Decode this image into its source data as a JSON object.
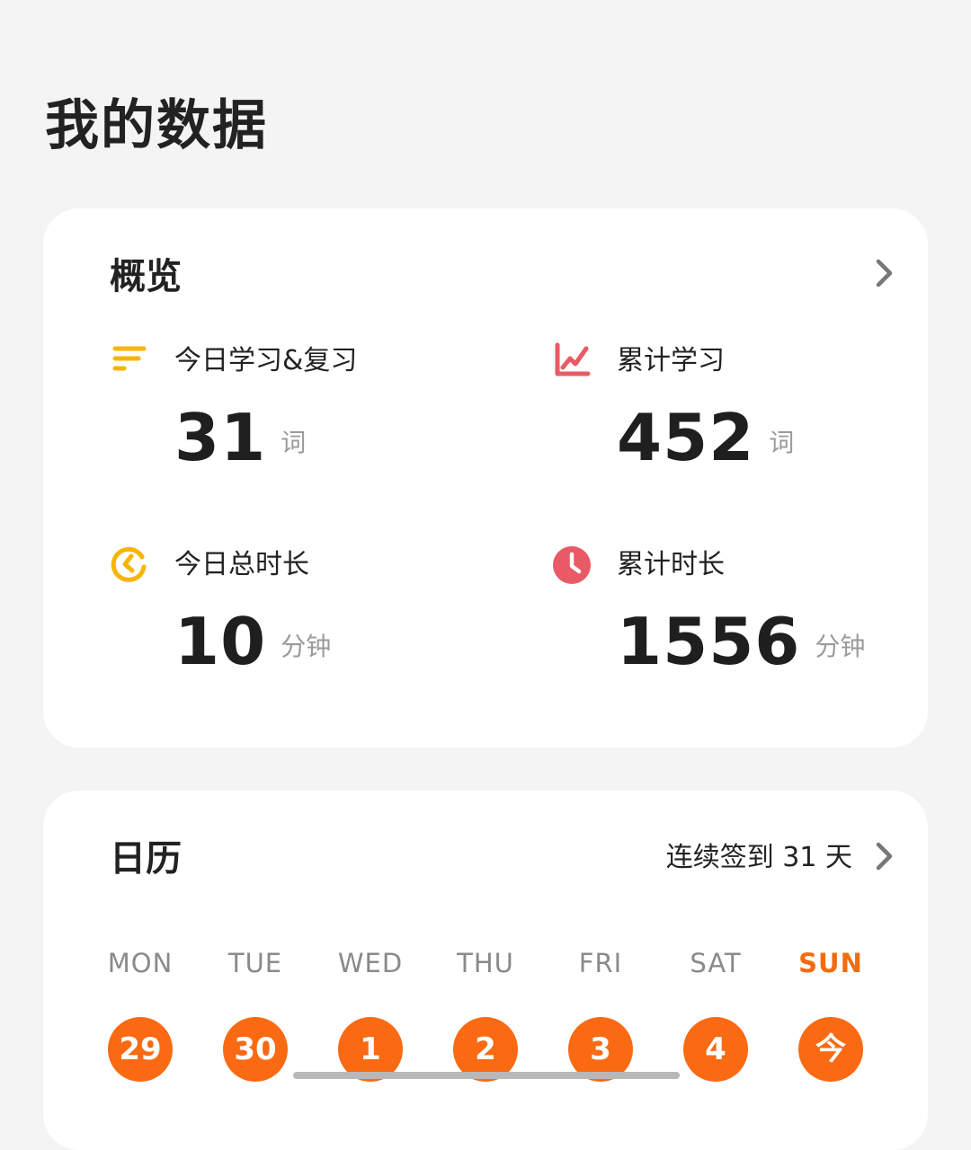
{
  "page": {
    "title": "我的数据"
  },
  "overview": {
    "title": "概览",
    "stats": [
      {
        "icon": "list-bars-icon",
        "label": "今日学习&复习",
        "value": "31",
        "unit": "词",
        "color": "#f7b500"
      },
      {
        "icon": "line-chart-icon",
        "label": "累计学习",
        "value": "452",
        "unit": "词",
        "color": "#e85a66"
      },
      {
        "icon": "timer-ring-icon",
        "label": "今日总时长",
        "value": "10",
        "unit": "分钟",
        "color": "#f7b500"
      },
      {
        "icon": "clock-icon",
        "label": "累计时长",
        "value": "1556",
        "unit": "分钟",
        "color": "#e85a66"
      }
    ]
  },
  "calendar": {
    "title": "日历",
    "streak": "连续签到 31 天",
    "weekdays": [
      "MON",
      "TUE",
      "WED",
      "THU",
      "FRI",
      "SAT",
      "SUN"
    ],
    "days": [
      "29",
      "30",
      "1",
      "2",
      "3",
      "4",
      "今"
    ],
    "accent": "#fa6a12"
  }
}
